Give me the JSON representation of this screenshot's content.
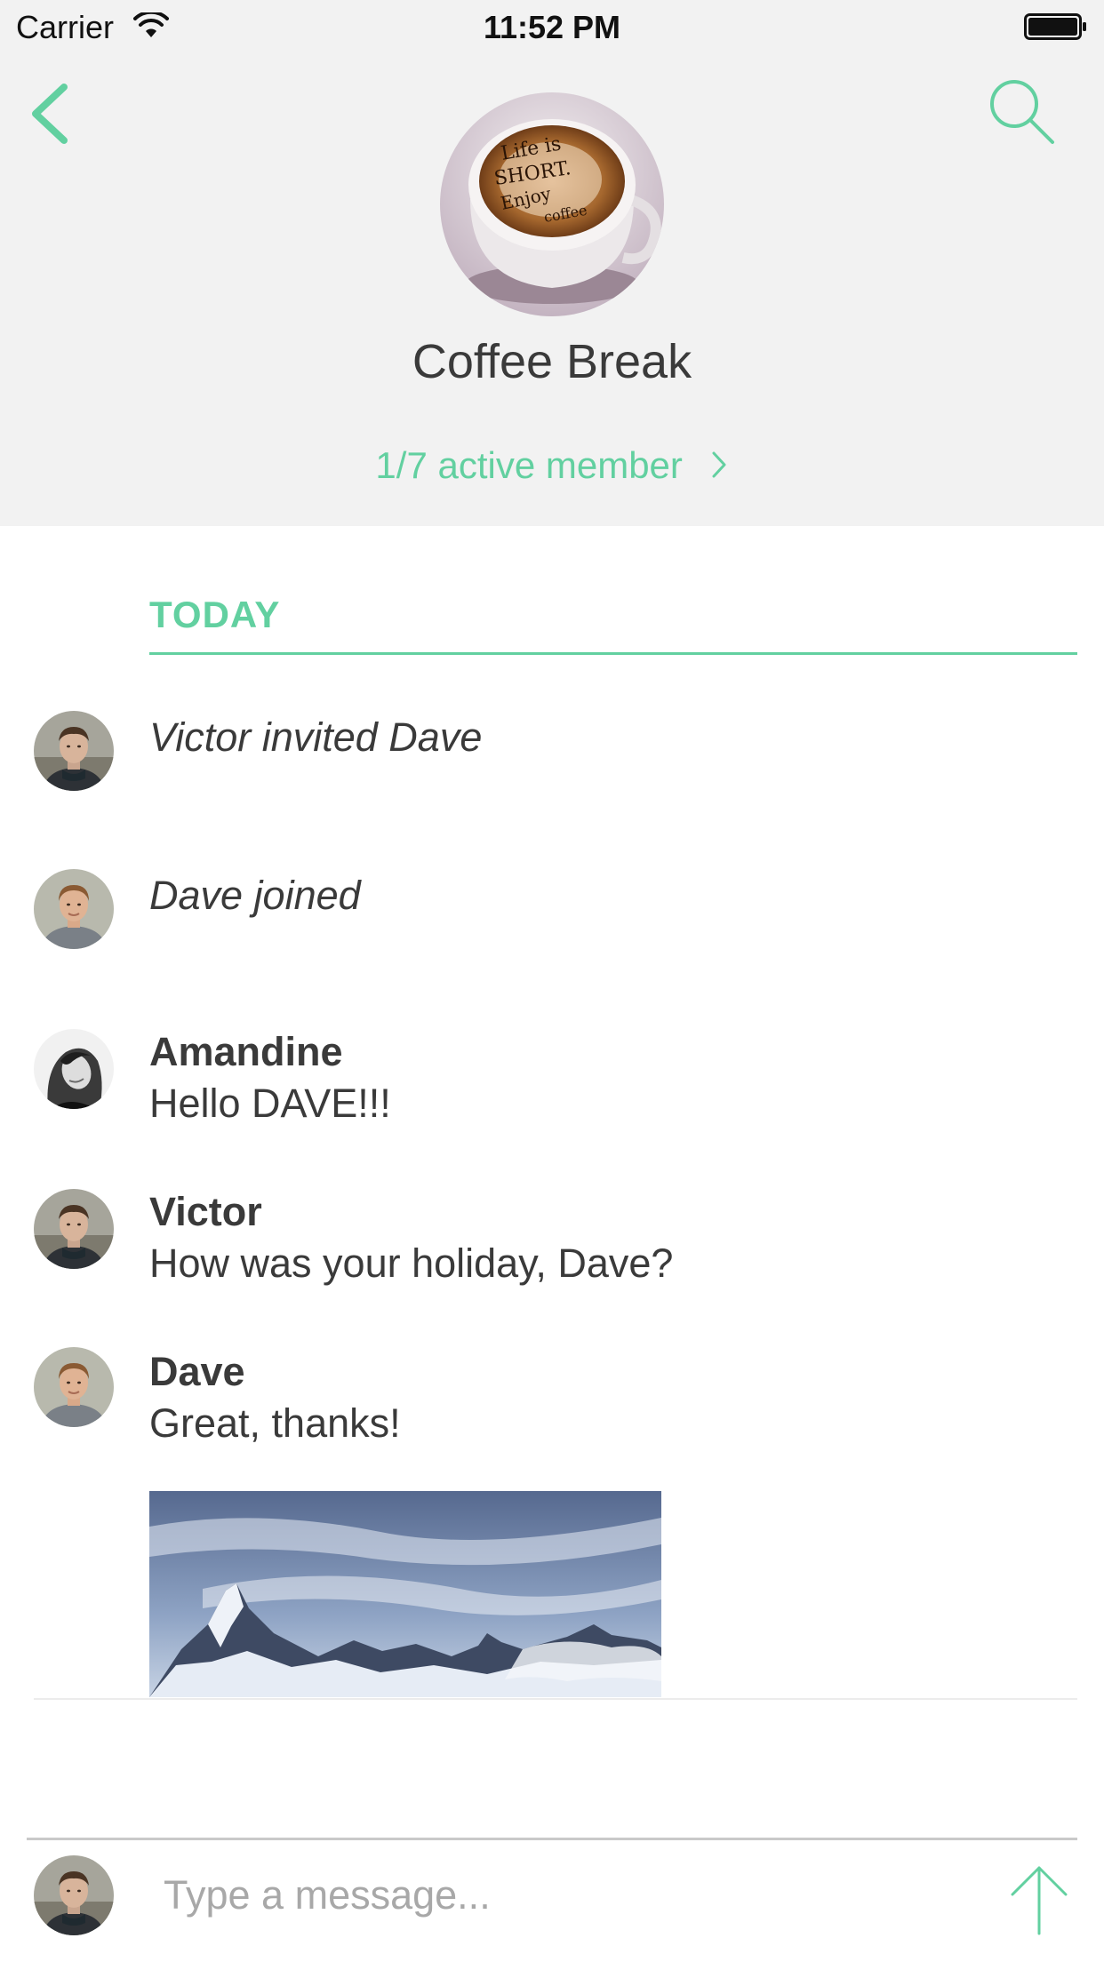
{
  "status_bar": {
    "carrier": "Carrier",
    "time": "11:52 PM",
    "wifi_icon": "wifi-icon",
    "battery_icon": "battery-icon"
  },
  "header": {
    "back_icon": "chevron-left-icon",
    "search_icon": "search-icon",
    "group_name": "Coffee Break",
    "members_label": "1/7 active member",
    "members_chevron_icon": "chevron-right-icon"
  },
  "conversation": {
    "day_label": "TODAY",
    "events": [
      {
        "avatar": "victor",
        "text": "Victor invited Dave"
      },
      {
        "avatar": "dave",
        "text": "Dave joined"
      }
    ],
    "messages": [
      {
        "avatar": "amandine",
        "sender": "Amandine",
        "text": "Hello DAVE!!!"
      },
      {
        "avatar": "victor",
        "sender": "Victor",
        "text": "How was your holiday, Dave?"
      },
      {
        "avatar": "dave",
        "sender": "Dave",
        "text": "Great, thanks!"
      }
    ],
    "attachment": "mountain-photo"
  },
  "composer": {
    "placeholder": "Type a message...",
    "value": "",
    "send_icon": "arrow-up-icon"
  },
  "colors": {
    "accent": "#62d0a0",
    "header_bg": "#f2f2f2",
    "text": "#3a3a3a",
    "placeholder": "#a8a8a8"
  }
}
